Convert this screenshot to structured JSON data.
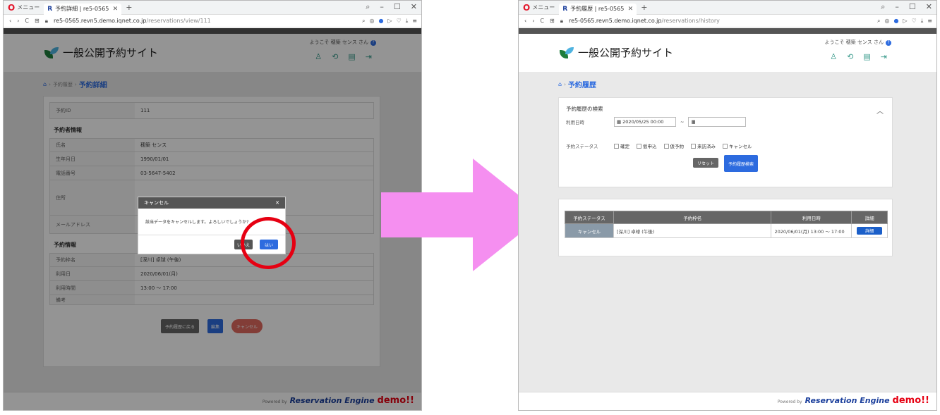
{
  "left": {
    "tab_menu_label": "メニュー",
    "tab_logo": "R",
    "tab_title": "予約詳細 | re5-0565",
    "url_domain": "re5-0565.revn5.demo.iqnet.co.jp",
    "url_path": "/reservations/view/111",
    "welcome": "ようこそ 穂築 センス さん",
    "site_name": "一般公開予約サイト",
    "breadcrumb": {
      "parent": "予約履歴",
      "current": "予約詳細"
    },
    "reservation_id_label": "予約ID",
    "reservation_id": "111",
    "section_person": "予約者情報",
    "person_rows": [
      {
        "label": "氏名",
        "value": "穂築 センス"
      },
      {
        "label": "生年月日",
        "value": "1990/01/01"
      },
      {
        "label": "電話番号",
        "value": "03-5647-5402"
      },
      {
        "label": "住所",
        "value": ""
      },
      {
        "label": "メールアドレス",
        "value": ""
      }
    ],
    "section_reservation": "予約情報",
    "reservation_rows": [
      {
        "label": "予約枠名",
        "value": "[深川] 卓球 (午後)"
      },
      {
        "label": "利用日",
        "value": "2020/06/01(月)"
      },
      {
        "label": "利用時間",
        "value": "13:00 ～ 17:00"
      },
      {
        "label": "備考",
        "value": ""
      }
    ],
    "buttons": {
      "back": "予約履歴に戻る",
      "edit": "編集",
      "cancel": "キャンセル"
    },
    "modal": {
      "title": "キャンセル",
      "message": "該当データをキャンセルします。よろしいでしょうか?",
      "no": "いいえ",
      "yes": "はい"
    },
    "powered": "Powered by",
    "brand": "Reservation Engine",
    "demo": "demo!!"
  },
  "right": {
    "tab_menu_label": "メニュー",
    "tab_logo": "R",
    "tab_title": "予約履歴 | re5-0565",
    "url_domain": "re5-0565.revn5.demo.iqnet.co.jp",
    "url_path": "/reservations/history",
    "welcome": "ようこそ 穂築 センス さん",
    "site_name": "一般公開予約サイト",
    "breadcrumb": {
      "current": "予約履歴"
    },
    "search": {
      "title": "予約履歴の検索",
      "date_label": "利用日時",
      "date_from": "2020/05/25 00:00",
      "tilde": "~",
      "status_label": "予約ステータス",
      "statuses": [
        "確定",
        "仮申込",
        "仮予約",
        "来訪済み",
        "キャンセル"
      ],
      "reset": "リセット",
      "submit": "予約履歴検索"
    },
    "table": {
      "headers": [
        "予約ステータス",
        "予約枠名",
        "利用日時",
        "詳細"
      ],
      "rows": [
        {
          "status": "キャンセル",
          "name": "[深川] 卓球 (午後)",
          "datetime": "2020/06/01(月) 13:00 ～ 17:00",
          "detail": "詳細"
        }
      ]
    },
    "powered": "Powered by",
    "brand": "Reservation Engine",
    "demo": "demo!!"
  },
  "colors": {
    "accent": "#2d6bdf",
    "cancel": "#e0695f",
    "highlight": "#e60012",
    "arrow": "#f58ff0"
  }
}
